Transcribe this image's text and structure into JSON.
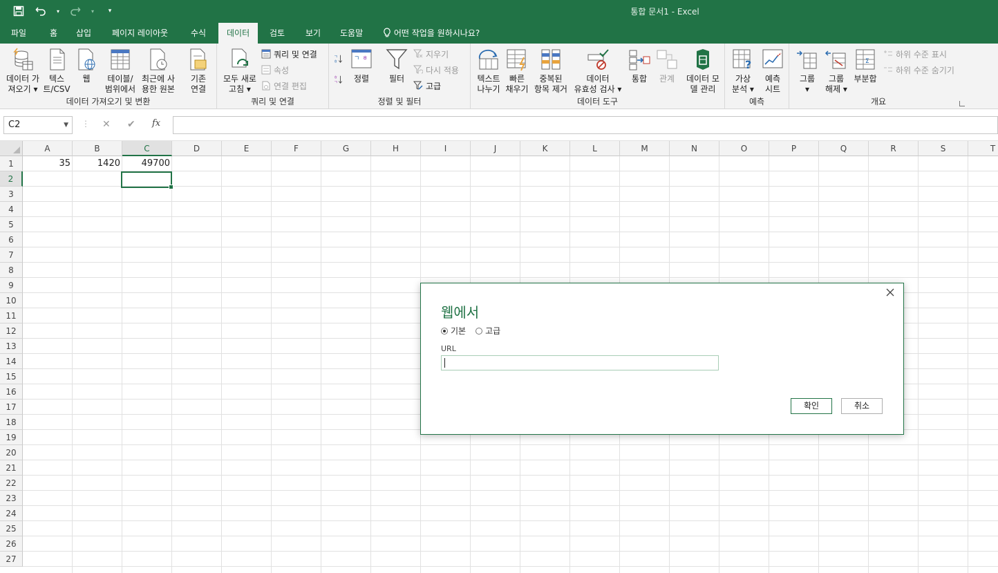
{
  "window": {
    "title": "통합 문서1  -  Excel"
  },
  "qat": {
    "save": "save-icon",
    "undo": "undo-icon",
    "redo": "redo-icon",
    "customize": "customize-icon"
  },
  "tabs": [
    "파일",
    "홈",
    "삽입",
    "페이지 레이아웃",
    "수식",
    "데이터",
    "검토",
    "보기",
    "도움말"
  ],
  "active_tab": "데이터",
  "tell_me": "어떤 작업을 원하시나요?",
  "ribbon": {
    "get_data": {
      "group_label": "데이터 가져오기 및 변환",
      "get_data_l1": "데이터 가",
      "get_data_l2": "져오기 ▾",
      "text_csv_l1": "텍스",
      "text_csv_l2": "트/CSV",
      "web": "웹",
      "table_l1": "테이블/",
      "table_l2": "범위에서",
      "recent_l1": "최근에 사",
      "recent_l2": "용한 원본",
      "existing_l1": "기존",
      "existing_l2": "연결"
    },
    "queries": {
      "group_label": "쿼리 및 연결",
      "refresh_l1": "모두 새로",
      "refresh_l2": "고침 ▾",
      "queries_conn": "쿼리 및 연결",
      "properties": "속성",
      "edit_links": "연결 편집"
    },
    "sort_filter": {
      "group_label": "정렬 및 필터",
      "sort": "정렬",
      "filter": "필터",
      "clear": "지우기",
      "reapply": "다시 적용",
      "advanced": "고급"
    },
    "data_tools": {
      "group_label": "데이터 도구",
      "text_to_col_l1": "텍스트",
      "text_to_col_l2": "나누기",
      "flash_fill_l1": "빠른",
      "flash_fill_l2": "채우기",
      "remove_dup_l1": "중복된",
      "remove_dup_l2": "항목 제거",
      "validation_l1": "데이터",
      "validation_l2": "유효성 검사 ▾",
      "consolidate": "통합",
      "relationships": "관계",
      "data_model_l1": "데이터 모",
      "data_model_l2": "델 관리"
    },
    "forecast": {
      "group_label": "예측",
      "whatif_l1": "가상",
      "whatif_l2": "분석 ▾",
      "sheet_l1": "예측",
      "sheet_l2": "시트"
    },
    "outline": {
      "group_label": "개요",
      "group_l1": "그룹",
      "group_l2": "▾",
      "ungroup_l1": "그룹",
      "ungroup_l2": "해제 ▾",
      "subtotal": "부분합",
      "show_detail": "하위 수준 표시",
      "hide_detail": "하위 수준 숨기기"
    }
  },
  "formula_bar": {
    "name_box": "C2",
    "cancel": "✕",
    "enter": "✔",
    "fx": "fx",
    "value": ""
  },
  "columns": [
    "A",
    "B",
    "C",
    "D",
    "E",
    "F",
    "G",
    "H",
    "I",
    "J",
    "K",
    "L",
    "M",
    "N",
    "O",
    "P",
    "Q",
    "R",
    "S",
    "T"
  ],
  "rows": [
    "1",
    "2",
    "3",
    "4",
    "5",
    "6",
    "7",
    "8",
    "9",
    "10",
    "11",
    "12",
    "13",
    "14",
    "15",
    "16",
    "17",
    "18",
    "19",
    "20",
    "21",
    "22",
    "23",
    "24",
    "25",
    "26",
    "27"
  ],
  "selected_cell": "C2",
  "cells": {
    "A1": "35",
    "B1": "1420",
    "C1": "49700"
  },
  "dialog": {
    "title": "웹에서",
    "radio_basic": "기본",
    "radio_advanced": "고급",
    "selected_mode": "기본",
    "url_label": "URL",
    "url_value": "",
    "ok": "확인",
    "cancel": "취소"
  },
  "colors": {
    "accent": "#217346",
    "ribbon_bg": "#f3f3f3",
    "grid_line": "#e1e1e1"
  }
}
